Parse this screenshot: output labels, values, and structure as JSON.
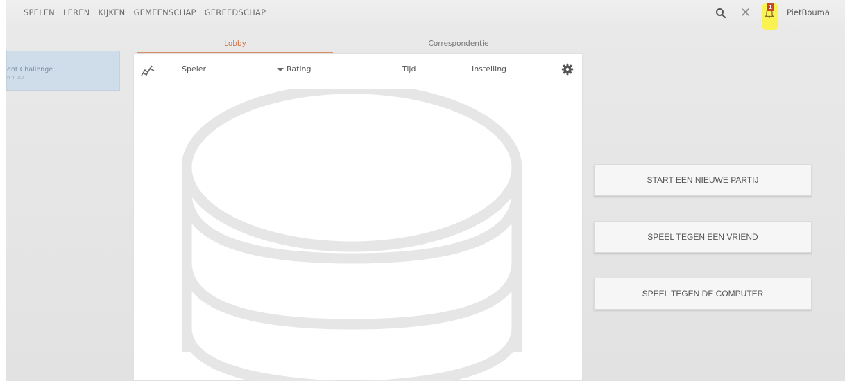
{
  "nav": {
    "items": [
      "SPELEN",
      "LEREN",
      "KIJKEN",
      "GEMEENSCHAP",
      "GEREEDSCHAP"
    ]
  },
  "header": {
    "icons": [
      "search-icon",
      "close-icon",
      "bell-icon"
    ],
    "notification_count": "1",
    "username": "PietBouma",
    "highlight_color": "#fbf24a"
  },
  "challenge": {
    "title": "ent Challenge",
    "subtitle": "n 4 uur"
  },
  "tabs": {
    "lobby": "Lobby",
    "correspondence": "Correspondentie",
    "active_color": "#d2754a"
  },
  "lobby": {
    "columns": {
      "player": "Speler",
      "rating": "Rating",
      "time": "Tijd",
      "setting": "Instelling"
    },
    "icons": [
      "graph-icon",
      "gear-icon",
      "database-icon"
    ]
  },
  "actions": {
    "new_game": "START EEN NIEUWE PARTIJ",
    "vs_friend": "SPEEL TEGEN EEN VRIEND",
    "vs_computer": "SPEEL TEGEN DE COMPUTER"
  }
}
